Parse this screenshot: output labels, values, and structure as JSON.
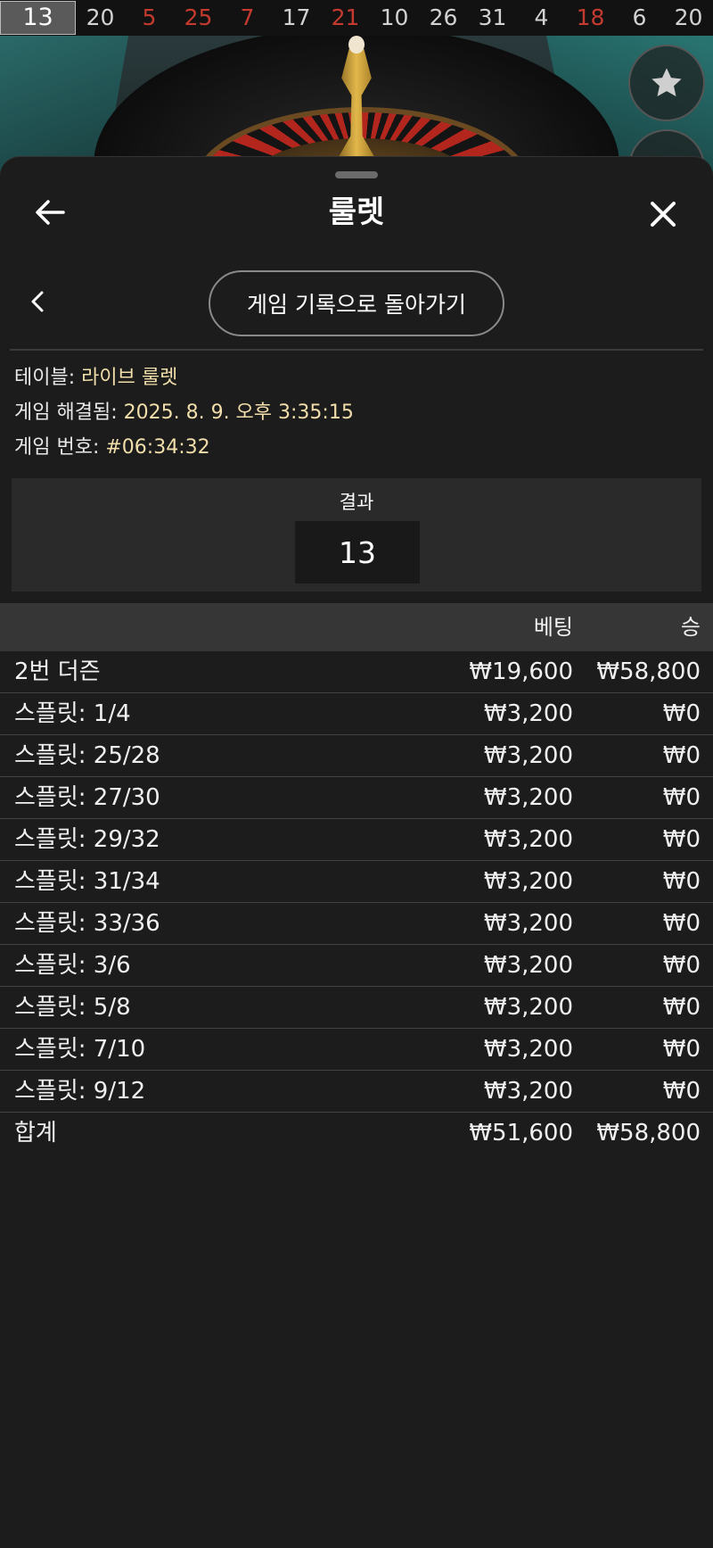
{
  "strip": {
    "numbers": [
      {
        "n": "13",
        "color": "current"
      },
      {
        "n": "20",
        "color": "black"
      },
      {
        "n": "5",
        "color": "red"
      },
      {
        "n": "25",
        "color": "red"
      },
      {
        "n": "7",
        "color": "red"
      },
      {
        "n": "17",
        "color": "black"
      },
      {
        "n": "21",
        "color": "red"
      },
      {
        "n": "10",
        "color": "black"
      },
      {
        "n": "26",
        "color": "black"
      },
      {
        "n": "31",
        "color": "black"
      },
      {
        "n": "4",
        "color": "black"
      },
      {
        "n": "18",
        "color": "red"
      },
      {
        "n": "6",
        "color": "black"
      },
      {
        "n": "20",
        "color": "black"
      }
    ]
  },
  "side_buttons": {
    "favorite_icon": "star-icon"
  },
  "header": {
    "title": "룰렛",
    "back_icon": "arrow-left-icon",
    "close_icon": "close-icon"
  },
  "nav": {
    "back_icon": "chevron-left-icon",
    "history_button": "게임 기록으로 돌아가기"
  },
  "info": {
    "table_label": "테이블: ",
    "table_value": "라이브 룰렛",
    "resolved_label": "게임 해결됨: ",
    "resolved_value": "2025. 8. 9. 오후 3:35:15",
    "game_no_label": "게임 번호: ",
    "game_no_value": "#06:34:32"
  },
  "result": {
    "label": "결과",
    "value": "13"
  },
  "table": {
    "headers": {
      "bet": "베팅",
      "win": "승"
    },
    "rows": [
      {
        "name": "2번 더즌",
        "bet": "₩19,600",
        "win": "₩58,800"
      },
      {
        "name": "스플릿: 1/4",
        "bet": "₩3,200",
        "win": "₩0"
      },
      {
        "name": "스플릿: 25/28",
        "bet": "₩3,200",
        "win": "₩0"
      },
      {
        "name": "스플릿: 27/30",
        "bet": "₩3,200",
        "win": "₩0"
      },
      {
        "name": "스플릿: 29/32",
        "bet": "₩3,200",
        "win": "₩0"
      },
      {
        "name": "스플릿: 31/34",
        "bet": "₩3,200",
        "win": "₩0"
      },
      {
        "name": "스플릿: 33/36",
        "bet": "₩3,200",
        "win": "₩0"
      },
      {
        "name": "스플릿: 3/6",
        "bet": "₩3,200",
        "win": "₩0"
      },
      {
        "name": "스플릿: 5/8",
        "bet": "₩3,200",
        "win": "₩0"
      },
      {
        "name": "스플릿: 7/10",
        "bet": "₩3,200",
        "win": "₩0"
      },
      {
        "name": "스플릿: 9/12",
        "bet": "₩3,200",
        "win": "₩0"
      }
    ],
    "total": {
      "name": "합계",
      "bet": "₩51,600",
      "win": "₩58,800"
    }
  },
  "colors": {
    "red": "#c53a2f",
    "accent_value": "#f1deaa",
    "background": "#1c1c1c"
  }
}
